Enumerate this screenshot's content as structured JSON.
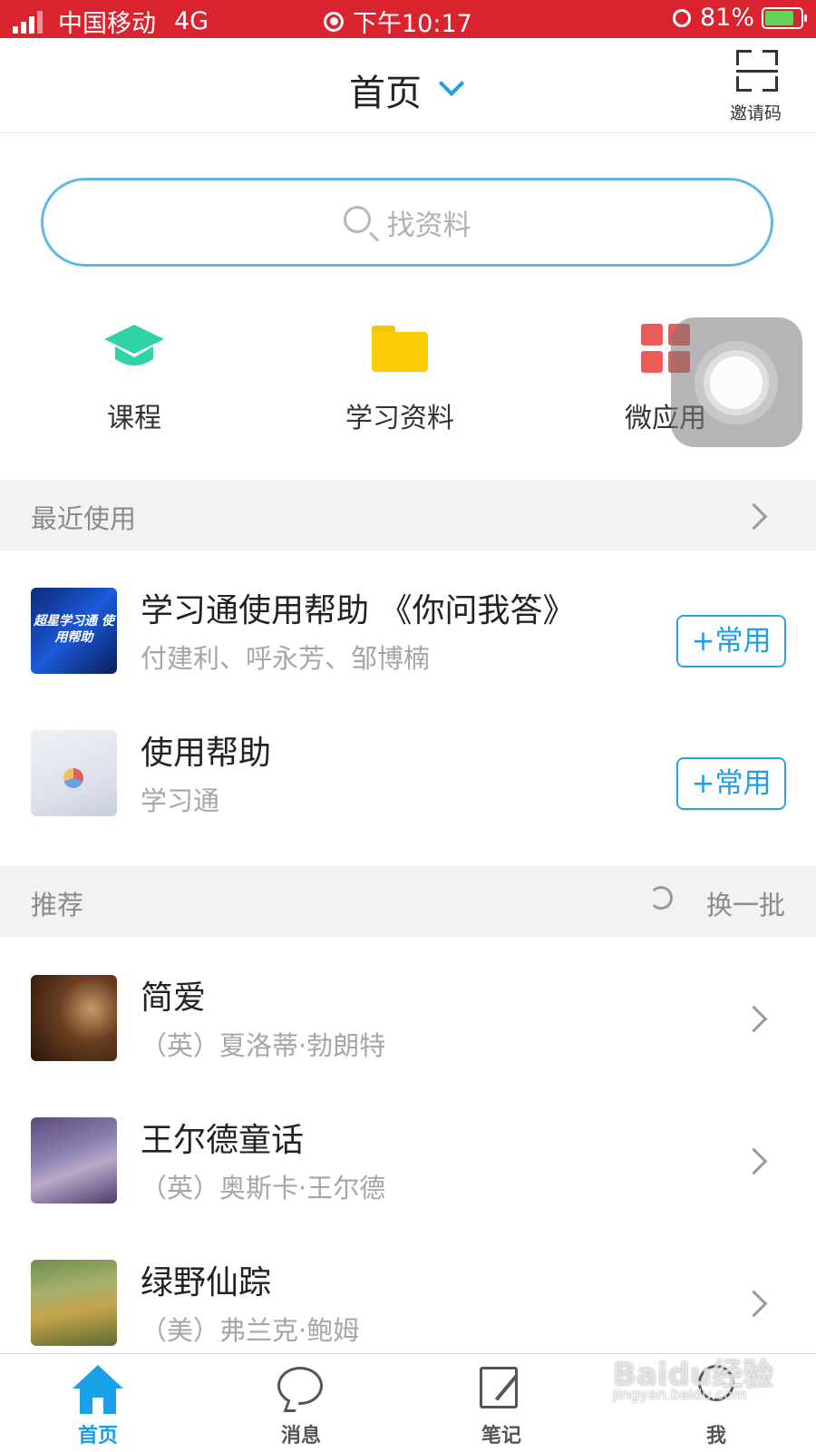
{
  "status_bar": {
    "carrier": "中国移动",
    "network": "4G",
    "time": "下午10:17",
    "battery": "81%",
    "battery_level": 0.81
  },
  "nav": {
    "title": "首页",
    "scan_label": "邀请码"
  },
  "search": {
    "placeholder": "找资料"
  },
  "quick_entries": [
    {
      "label": "课程",
      "icon": "graduation-cap-icon",
      "color": "#2fd3a6"
    },
    {
      "label": "学习资料",
      "icon": "folder-icon",
      "color": "#fccc06"
    },
    {
      "label": "微应用",
      "icon": "apps-grid-icon",
      "color": "#ec5c56"
    }
  ],
  "recent": {
    "header": "最近使用",
    "items": [
      {
        "title": "学习通使用帮助 《你问我答》",
        "subtitle": "付建利、呼永芳、邹博楠",
        "button": "+常用",
        "thumb_text": "超星学习通 使用帮助"
      },
      {
        "title": "使用帮助",
        "subtitle": "学习通",
        "button": "+常用"
      }
    ]
  },
  "recommend": {
    "header": "推荐",
    "refresh_label": "换一批",
    "items": [
      {
        "title": "简爱",
        "subtitle": "（英）夏洛蒂·勃朗特"
      },
      {
        "title": "王尔德童话",
        "subtitle": "（英）奥斯卡·王尔德"
      },
      {
        "title": "绿野仙踪",
        "subtitle": "（美）弗兰克·鲍姆"
      }
    ]
  },
  "tabs": [
    {
      "label": "首页",
      "icon": "home-icon",
      "active": true
    },
    {
      "label": "消息",
      "icon": "message-icon",
      "active": false
    },
    {
      "label": "笔记",
      "icon": "note-icon",
      "active": false
    },
    {
      "label": "我",
      "icon": "profile-icon",
      "active": false
    }
  ],
  "watermark": {
    "text": "Baidu经验",
    "sub": "jingyan.baidu.com"
  },
  "colors": {
    "status_bar": "#d9232f",
    "accent": "#1aa1de"
  }
}
